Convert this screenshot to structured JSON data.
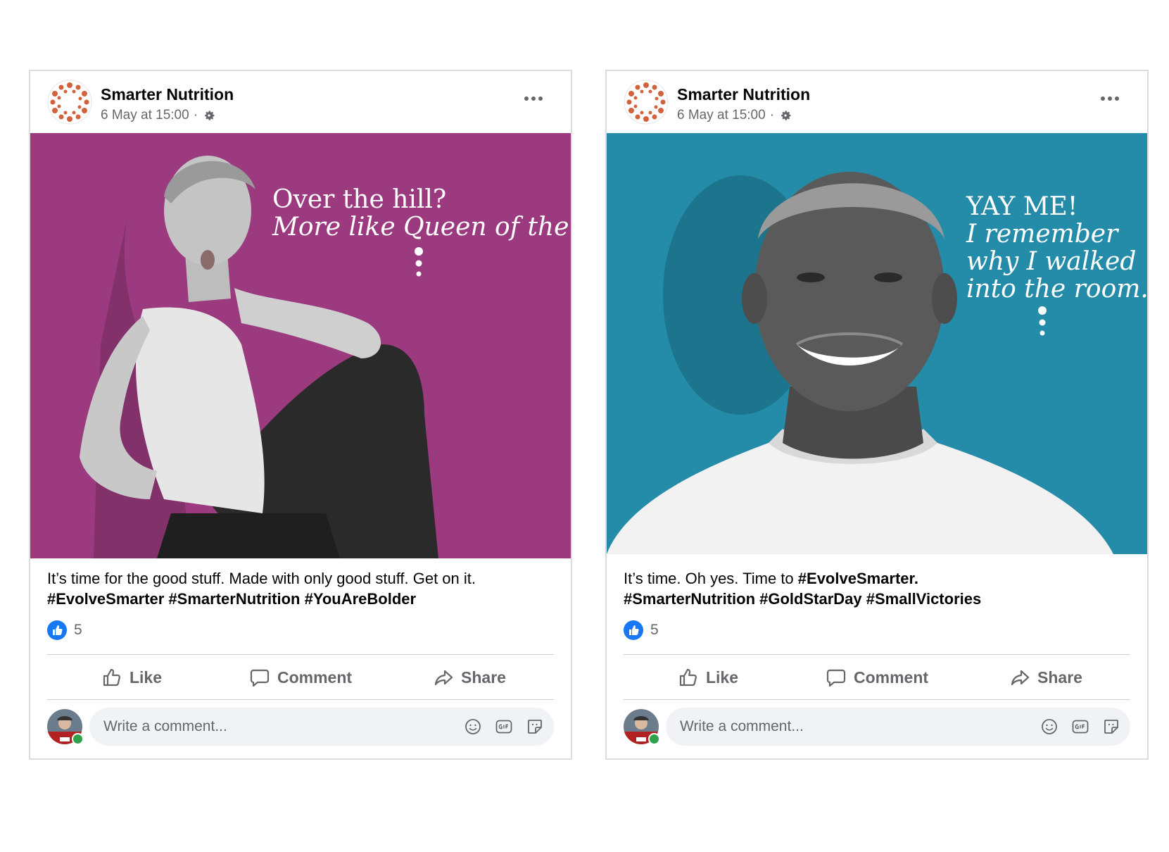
{
  "posts": [
    {
      "page_name": "Smarter Nutrition",
      "timestamp": "6 May at 15:00",
      "separator": "·",
      "headline": [
        "Over the hill?",
        "More like Queen of the hill."
      ],
      "caption_text": "It’s time for the good stuff. Made with only good stuff. Get on it.",
      "caption_tags": "#EvolveSmarter #SmarterNutrition #YouAreBolder",
      "background_color": "#9b3a7e",
      "reaction_count": "5",
      "actions": {
        "like": "Like",
        "comment": "Comment",
        "share": "Share"
      },
      "comment_placeholder": "Write a comment..."
    },
    {
      "page_name": "Smarter Nutrition",
      "timestamp": "6 May at 15:00",
      "separator": "·",
      "headline": [
        "YAY ME!",
        "I remember",
        "why I walked",
        "into the room."
      ],
      "caption_text": "It’s time. Oh yes. Time to ",
      "caption_tags_inline": "#EvolveSmarter.",
      "caption_tags": "#SmarterNutrition #GoldStarDay #SmallVictories",
      "background_color": "#248ca8",
      "reaction_count": "5",
      "actions": {
        "like": "Like",
        "comment": "Comment",
        "share": "Share"
      },
      "comment_placeholder": "Write a comment..."
    }
  ],
  "colors": {
    "brand_orange": "#d2623c",
    "like_blue": "#1877f2",
    "online_green": "#31a24c"
  },
  "icons": [
    "logo-ring-icon",
    "gear-icon",
    "more-options-icon",
    "like-badge-icon",
    "thumbs-up-icon",
    "comment-icon",
    "share-icon",
    "emoji-icon",
    "gif-icon",
    "sticker-icon"
  ]
}
